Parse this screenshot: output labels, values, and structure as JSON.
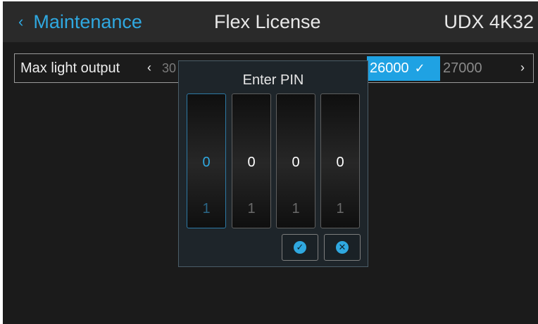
{
  "header": {
    "back_chevron": "‹",
    "back_label": "Maintenance",
    "title": "Flex License",
    "model": "UDX 4K32"
  },
  "setting": {
    "label": "Max light output",
    "left_arrow": "‹",
    "partial_value": "30",
    "selected_value": "26000",
    "selected_check": "✓",
    "next_value": "27000",
    "right_arrow": "›"
  },
  "pin_dialog": {
    "title": "Enter PIN",
    "digits": [
      {
        "current": "0",
        "next": "1"
      },
      {
        "current": "0",
        "next": "1"
      },
      {
        "current": "0",
        "next": "1"
      },
      {
        "current": "0",
        "next": "1"
      }
    ],
    "active_digit_index": 0,
    "confirm_symbol": "✓",
    "cancel_symbol": "✕"
  },
  "colors": {
    "accent": "#2fa8e0",
    "selection": "#1fa2e3",
    "header_bg": "#2a2a2a",
    "screen_bg": "#1b1b1b"
  }
}
